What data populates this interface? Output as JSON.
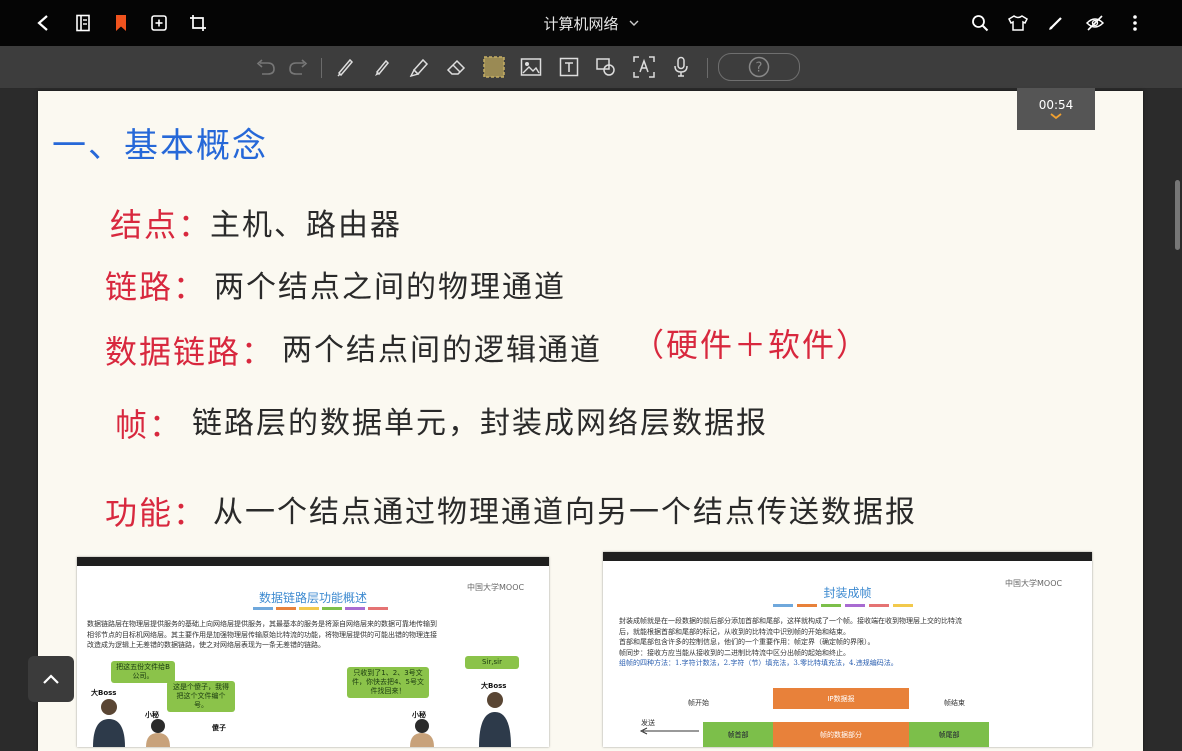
{
  "app": {
    "title": "计算机网络",
    "timer": "00:54"
  },
  "toolbar": {
    "help": "?"
  },
  "notes": {
    "heading": "一、基本概念",
    "lines": [
      {
        "term": "结点：",
        "text": "主机、路由器"
      },
      {
        "term": "链路：",
        "text": "两个结点之间的物理通道"
      },
      {
        "term": "数据链路：",
        "text": "两个结点间的逻辑通道",
        "extra": "（硬件＋软件）"
      },
      {
        "term": "帧：",
        "text": "链路层的数据单元，封装成网络层数据报"
      },
      {
        "term": "功能：",
        "text": "从一个结点通过物理通道向另一个结点传送数据报"
      }
    ]
  },
  "slide1": {
    "title": "数据链路层功能概述",
    "logo": "中国大学MOOC",
    "paragraph": [
      "数据链路层在物理层提供服务的基础上向网络层提供服务，其最基本的服务是将源自网络层来的数据可靠地传输到",
      "相邻节点的目标机网络层。其主要作用是加强物理层传输原始比特流的功能，将物理层提供的可能出错的物理连接",
      "改造成为逻辑上无差错的数据链路，使之对网络层表现为一条无差错的链路。"
    ],
    "bubbles": [
      "把这五份文件给B公司。",
      "这是个傻子，我得把这个文件编个号。",
      "只收到了1、2、3号文件，你快去把4、5号文件找回来！",
      "Sir,sir"
    ],
    "labels": [
      "大Boss",
      "小秘",
      "傻子",
      "小秘",
      "大Boss"
    ]
  },
  "slide2": {
    "title": "封装成帧",
    "logo": "中国大学MOOC",
    "paragraph": [
      "封装成帧就是在一段数据的前后部分添加首部和尾部，这样就构成了一个帧。接收端在收到物理层上交的比特流",
      "后，就能根据首部和尾部的标记，从收到的比特流中识别帧的开始和结束。",
      "首部和尾部包含许多的控制信息，他们的一个重要作用：帧定界（确定帧的界限）。",
      "帧同步：接收方应当能从接收到的二进制比特流中区分出帧的起始和终止。",
      "组帧的四种方法：1.字符计数法，2.字符（节）填充法，3.零比特填充法，4.违规编码法。"
    ],
    "diagram": {
      "data": "IP数据报",
      "start": "帧开始",
      "end": "帧结束",
      "send": "发送",
      "header": "帧首部",
      "payload": "帧的数据部分",
      "trailer": "帧尾部"
    }
  },
  "colors": {
    "blue_ink": "#2668d8",
    "red_ink": "#d8283e",
    "orange": "#e8813a",
    "green": "#7cbf4a"
  }
}
